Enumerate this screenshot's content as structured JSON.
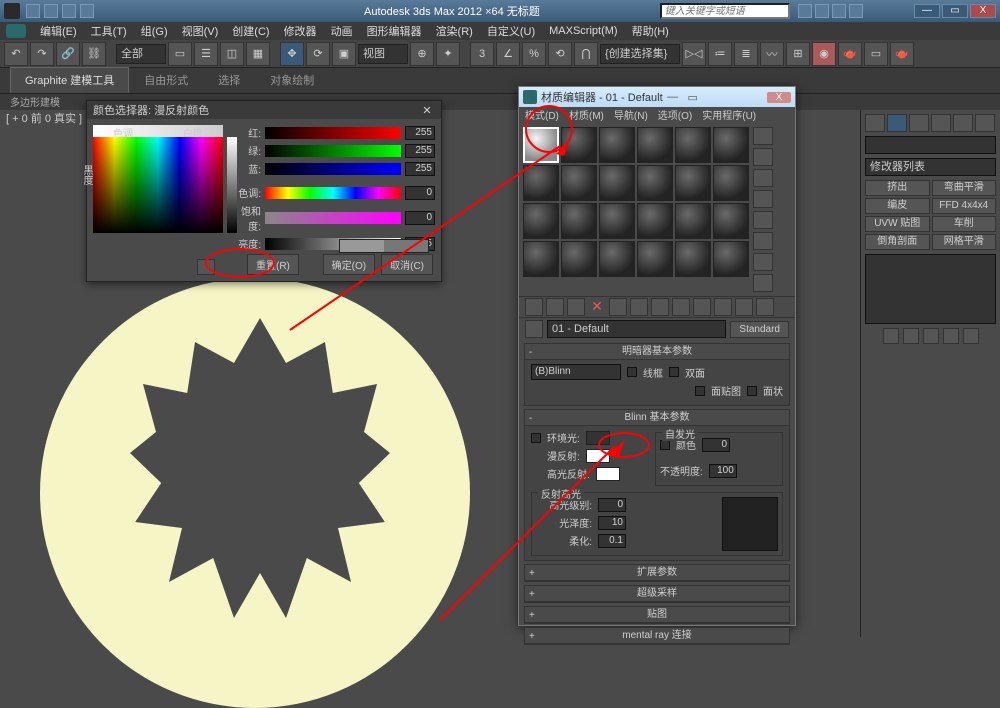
{
  "app": {
    "title": "Autodesk 3ds Max 2012 ×64   无标题",
    "search_placeholder": "键入关键字或短语"
  },
  "winbtns": {
    "min": "—",
    "max": "▭",
    "close": "X"
  },
  "menu": [
    "编辑(E)",
    "工具(T)",
    "组(G)",
    "视图(V)",
    "创建(C)",
    "修改器",
    "动画",
    "图形编辑器",
    "渲染(R)",
    "自定义(U)",
    "MAXScript(M)",
    "帮助(H)"
  ],
  "toolbar": {
    "all": "全部",
    "view": "视图",
    "selset": "{创建选择集}"
  },
  "ribbon": {
    "t1": "Graphite 建模工具",
    "t2": "自由形式",
    "t3": "选择",
    "t4": "对象绘制"
  },
  "subheader": "多边形建模",
  "viewport_label": "[ + 0 前 0 真实 ]",
  "cmd": {
    "modlist": "修改器列表",
    "b1": "挤出",
    "b2": "弯曲平滑",
    "b3": "编皮",
    "b4": "FFD 4x4x4",
    "b5": "UVW 贴图",
    "b6": "车削",
    "b7": "倒角剖面",
    "b8": "网格平滑"
  },
  "colorpicker": {
    "title": "颜色选择器: 漫反射颜色",
    "hue": "色调",
    "whiteness": "白度",
    "blackness": "黑度",
    "red": "红:",
    "green": "绿:",
    "blue": "蓝:",
    "hue2": "色调:",
    "sat": "饱和度:",
    "val": "亮度:",
    "v_r": "255",
    "v_g": "255",
    "v_b": "255",
    "v_h": "0",
    "v_s": "0",
    "v_v": "255",
    "reset": "重置(R)",
    "ok": "确定(O)",
    "cancel": "取消(C)",
    "close": "✕"
  },
  "mateditor": {
    "title": "材质编辑器 - 01 - Default",
    "menu": [
      "模式(D)",
      "材质(M)",
      "导航(N)",
      "选项(O)",
      "实用程序(U)"
    ],
    "matname": "01 - Default",
    "standard": "Standard",
    "roll_shader": "明暗器基本参数",
    "shader": "(B)Blinn",
    "wire": "线框",
    "twoside": "双面",
    "facemap": "面贴图",
    "faceted": "面状",
    "roll_blinn": "Blinn 基本参数",
    "selfillum_g": "自发光",
    "colorchk": "颜色",
    "si_val": "0",
    "ambient": "环境光:",
    "diffuse": "漫反射:",
    "specular": "高光反射:",
    "opacity": "不透明度:",
    "op_val": "100",
    "reflect_g": "反射高光",
    "speclevel": "高光级别:",
    "sl_val": "0",
    "gloss": "光泽度:",
    "gl_val": "10",
    "soften": "柔化:",
    "so_val": "0.1",
    "roll_ext": "扩展参数",
    "roll_ss": "超级采样",
    "roll_maps": "贴图",
    "roll_mr": "mental ray 连接"
  }
}
